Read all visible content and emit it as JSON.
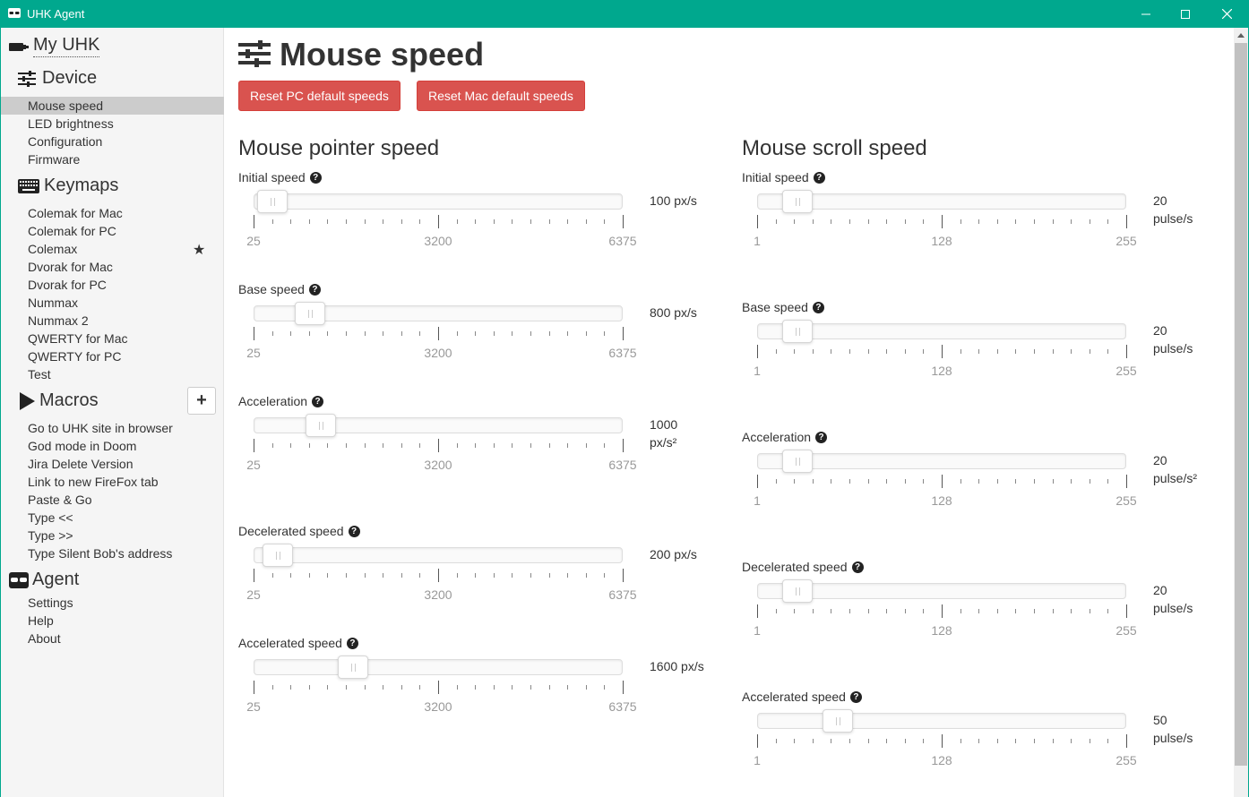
{
  "window": {
    "title": "UHK Agent",
    "accent_color": "#00a88e"
  },
  "sidebar": {
    "my_uhk": "My UHK",
    "device": {
      "title": "Device",
      "items": [
        "Mouse speed",
        "LED brightness",
        "Configuration",
        "Firmware"
      ],
      "active": "Mouse speed"
    },
    "keymaps": {
      "title": "Keymaps",
      "items": [
        "Colemak for Mac",
        "Colemak for PC",
        "Colemax",
        "Dvorak for Mac",
        "Dvorak for PC",
        "Nummax",
        "Nummax 2",
        "QWERTY for Mac",
        "QWERTY for PC",
        "Test"
      ],
      "default_keymap": "Colemax"
    },
    "macros": {
      "title": "Macros",
      "add_label": "+",
      "items": [
        "Go to UHK site in browser",
        "God mode in Doom",
        "Jira Delete Version",
        "Link to new FireFox tab",
        "Paste & Go",
        "Type <<",
        "Type >>",
        "Type Silent Bob's address"
      ]
    },
    "agent": {
      "title": "Agent",
      "items": [
        "Settings",
        "Help",
        "About"
      ]
    }
  },
  "main": {
    "title": "Mouse speed",
    "reset_pc": "Reset PC default speeds",
    "reset_mac": "Reset Mac default speeds",
    "button_color": "#d9534f",
    "help_glyph": "?",
    "pointer": {
      "title": "Mouse pointer speed",
      "min_label": "25",
      "mid_label": "3200",
      "max_label": "6375",
      "min": 25,
      "max": 6375,
      "settings": [
        {
          "label": "Initial speed",
          "value": 100,
          "display": [
            "100 px/s"
          ]
        },
        {
          "label": "Base speed",
          "value": 800,
          "display": [
            "800 px/s"
          ]
        },
        {
          "label": "Acceleration",
          "value": 1000,
          "display": [
            "1000",
            "px/s²"
          ]
        },
        {
          "label": "Decelerated speed",
          "value": 200,
          "display": [
            "200 px/s"
          ]
        },
        {
          "label": "Accelerated speed",
          "value": 1600,
          "display": [
            "1600 px/s"
          ]
        }
      ]
    },
    "scroll": {
      "title": "Mouse scroll speed",
      "min_label": "1",
      "mid_label": "128",
      "max_label": "255",
      "min": 1,
      "max": 255,
      "settings": [
        {
          "label": "Initial speed",
          "value": 20,
          "display": [
            "20",
            "pulse/s"
          ]
        },
        {
          "label": "Base speed",
          "value": 20,
          "display": [
            "20",
            "pulse/s"
          ]
        },
        {
          "label": "Acceleration",
          "value": 20,
          "display": [
            "20",
            "pulse/s²"
          ]
        },
        {
          "label": "Decelerated speed",
          "value": 20,
          "display": [
            "20",
            "pulse/s"
          ]
        },
        {
          "label": "Accelerated speed",
          "value": 50,
          "display": [
            "50",
            "pulse/s"
          ]
        }
      ]
    }
  }
}
